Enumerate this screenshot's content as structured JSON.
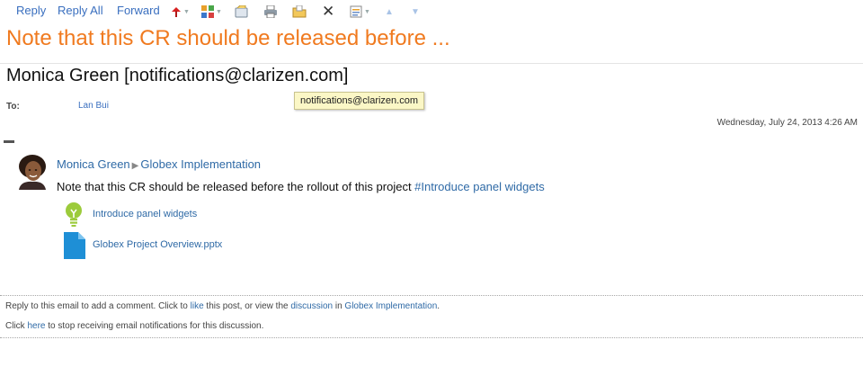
{
  "toolbar": {
    "reply": "Reply",
    "reply_all": "Reply All",
    "forward": "Forward",
    "icons": [
      "flag-icon",
      "categories-icon",
      "move-icon",
      "print-icon",
      "open-folder-icon",
      "delete-icon",
      "rules-icon",
      "up-arrow-icon",
      "down-arrow-icon"
    ]
  },
  "email": {
    "subject": "Note that this CR should be released before ...",
    "sender": "Monica Green [notifications@clarizen.com]",
    "tooltip": "notifications@clarizen.com",
    "to_label": "To:",
    "to_value": "Lan Bui",
    "date": "Wednesday, July 24, 2013 4:26 AM"
  },
  "post": {
    "author": "Monica Green",
    "project": "Globex Implementation",
    "message": "Note that this CR should be released before the rollout of this project ",
    "hashtag": "#Introduce panel widgets",
    "attachments": [
      {
        "label": "Introduce panel widgets",
        "icon": "lightbulb-icon"
      },
      {
        "label": "Globex Project Overview.pptx",
        "icon": "document-icon"
      }
    ]
  },
  "footer": {
    "l1_a": "Reply to this email to add a comment. Click to ",
    "l1_like": "like",
    "l1_b": " this post, or view the ",
    "l1_discussion": "discussion",
    "l1_c": " in ",
    "l1_project": "Globex Implementation",
    "l1_d": ".",
    "l2_a": "Click ",
    "l2_here": "here",
    "l2_b": " to stop receiving email notifications for this discussion."
  },
  "colors": {
    "subject": "#f07a1f",
    "link": "#2f6aa6",
    "toolbar_link": "#3a6fbf"
  }
}
